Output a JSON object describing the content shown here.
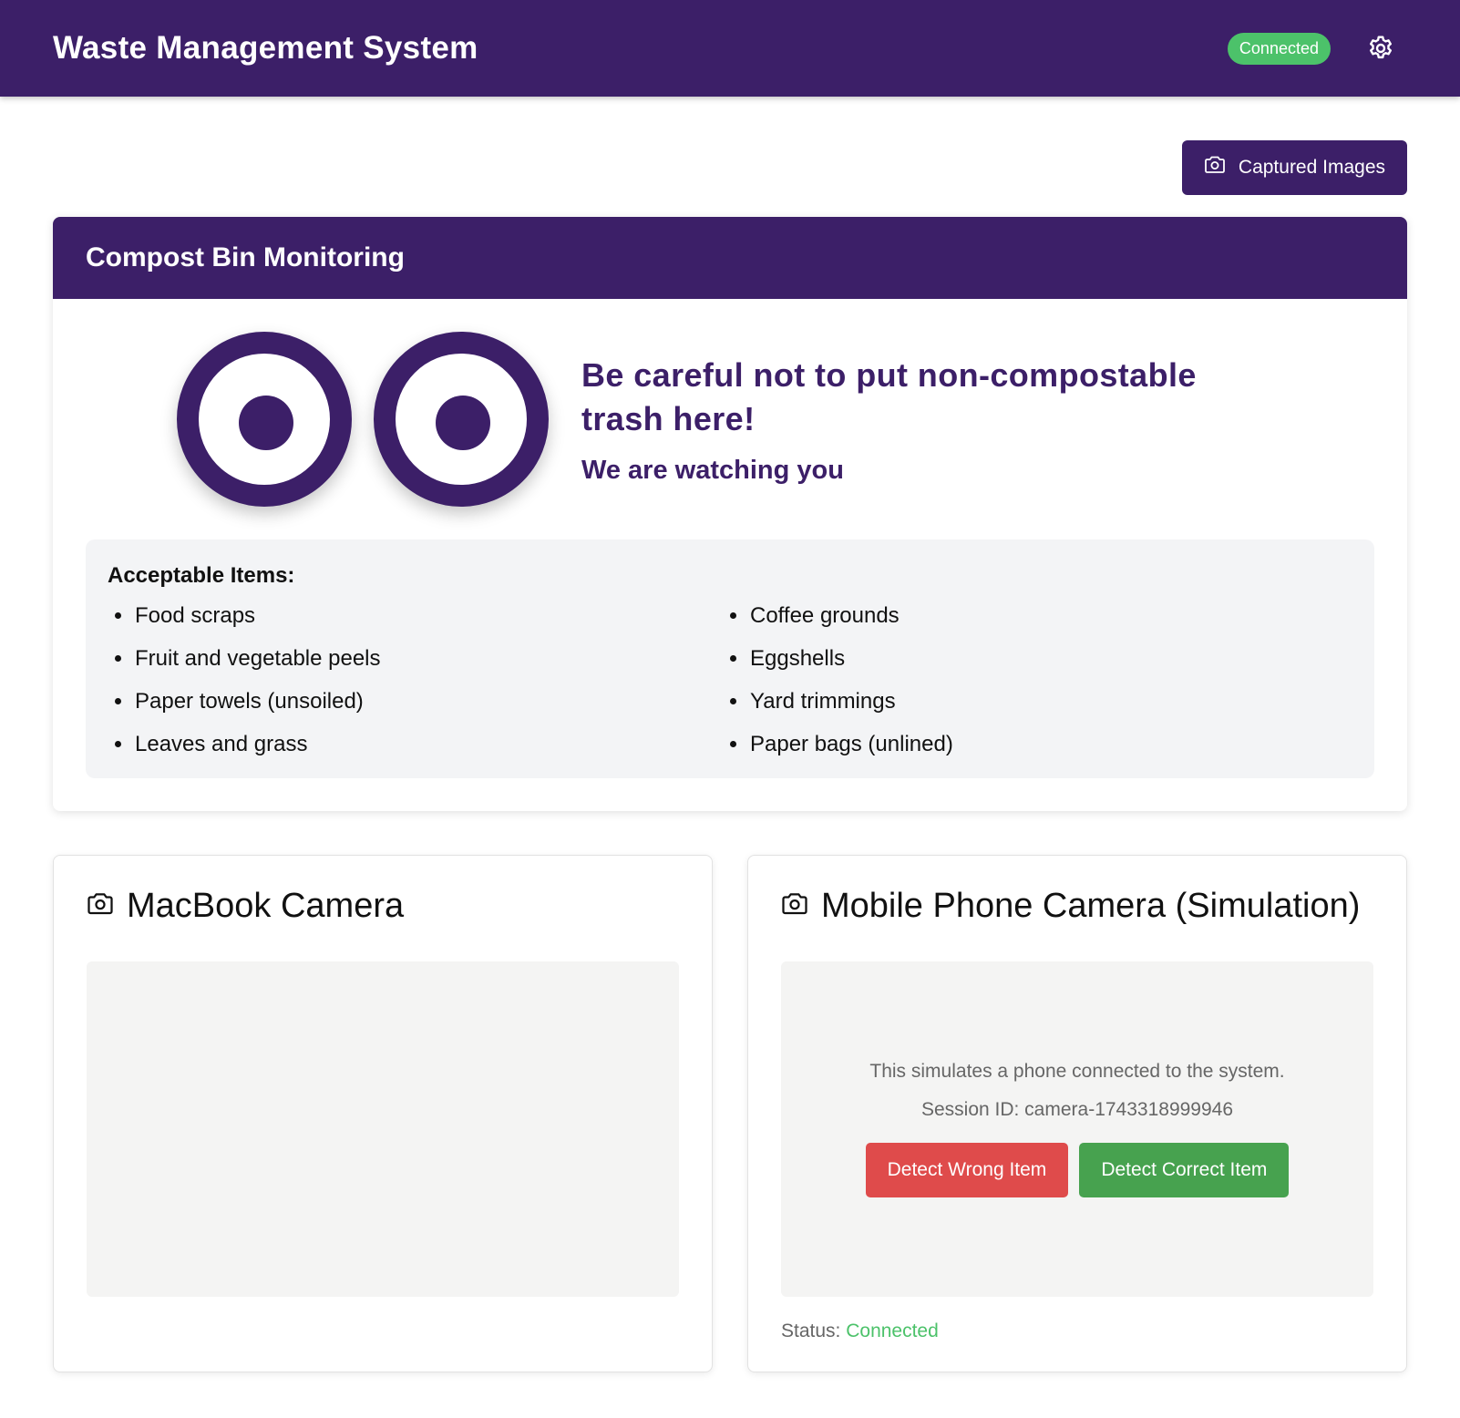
{
  "header": {
    "title": "Waste Management System",
    "connection_badge": "Connected",
    "settings_icon": "gear-icon"
  },
  "toolbar": {
    "captured_images_label": "Captured Images",
    "captured_images_icon": "camera-icon"
  },
  "compost": {
    "title": "Compost Bin Monitoring",
    "warning": "Be careful not to put non-compostable trash here!",
    "subwarning": "We are watching you",
    "acceptable_title": "Acceptable Items:",
    "items": [
      "Food scraps",
      "Coffee grounds",
      "Fruit and vegetable peels",
      "Eggshells",
      "Paper towels (unsoiled)",
      "Yard trimmings",
      "Leaves and grass",
      "Paper bags (unlined)"
    ]
  },
  "cameras": {
    "macbook": {
      "title": "MacBook Camera",
      "icon": "camera-icon"
    },
    "mobile": {
      "title": "Mobile Phone Camera (Simulation)",
      "icon": "camera-icon",
      "description": "This simulates a phone connected to the system.",
      "session": "Session ID: camera-1743318999946",
      "detect_wrong_label": "Detect Wrong Item",
      "detect_correct_label": "Detect Correct Item",
      "status_label": "Status:",
      "status_value": "Connected"
    }
  },
  "colors": {
    "brand_purple": "#3c1f68",
    "connected_green": "#4cc26a",
    "wrong_red": "#df4b4b",
    "correct_green": "#47a24f"
  }
}
